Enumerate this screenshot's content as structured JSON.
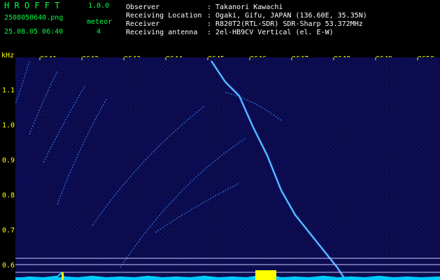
{
  "app": {
    "title": "H R O F F T",
    "version": "1.0.0",
    "filename": "2508050640.png",
    "datetime": "25.08.05 06:40",
    "meteor_label": "meteor",
    "meteor_count": "4"
  },
  "info": {
    "observer_label": "Observer",
    "observer_value": ": Takanori Kawachi",
    "location_label": "Receiving Location",
    "location_value": ": Ogaki, Gifu, JAPAN (136.60E, 35.35N)",
    "receiver_label": "Receiver",
    "receiver_value": ": R820T2(RTL-SDR) SDR-Sharp 53.372MHz",
    "antenna_label": "Receiving antenna",
    "antenna_value": ": 2el-HB9CV Vertical (el. E-W)"
  },
  "axis": {
    "y_unit": "kHz",
    "y_ticks": [
      "1.1",
      "1.0",
      "0.9",
      "0.8",
      "0.7",
      "0.6"
    ],
    "x_ticks": [
      "0641",
      "0642",
      "0643",
      "0644",
      "0645",
      "0646",
      "0647",
      "0648",
      "0649",
      "0650"
    ]
  },
  "colors": {
    "background": "#000000",
    "spectrogram_bg": "#0a0a4a",
    "trace": "#40a0ff",
    "meteor": "#80ffff",
    "header_green": "#00ff40",
    "header_yellow": "#ffff00",
    "baseline": "#00e0ff",
    "marker": "#ffff00"
  }
}
